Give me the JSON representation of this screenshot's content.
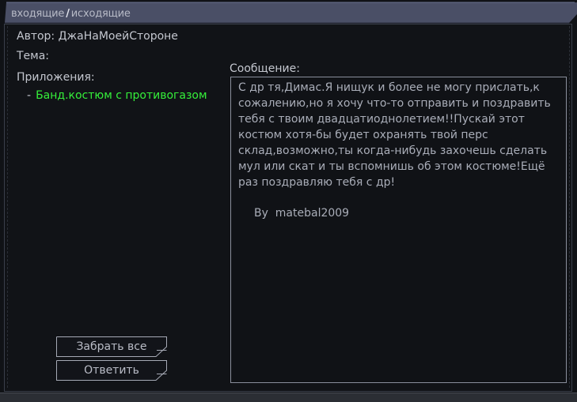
{
  "tabs": {
    "inbox": "входящие",
    "separator": "/",
    "outbox": "исходящие"
  },
  "message": {
    "author_label": "Автор: ДжаНаМоейСтороне",
    "subject_label": "Тема:",
    "attachments_label": "Приложения:",
    "attachments": [
      {
        "dash": "-",
        "name": "Банд.костюм с противогазом"
      }
    ],
    "body_label": "Сообщение:",
    "body": "С др тя,Димас.Я нищук и более не могу прислать,к сожалению,но я хочу что-то отправить и поздравить тебя с твоим двадцатиоднолетием!!Пускай этот костюм хотя-бы будет охранять твой перс склад,возможно,ты когда-нибудь захочешь сделать мул или скат и ты вспомнишь об этом костюме!Ещё раз поздравляю тебя с др!",
    "signature": "By  matebal2009"
  },
  "buttons": {
    "take_all": "Забрать все",
    "reply": "Ответить"
  },
  "colors": {
    "background": "#101216",
    "header_bar": "#4a4f66",
    "attachment_link": "#35f03a",
    "text": "#c4c7cf",
    "border": "#8a8f9c"
  }
}
